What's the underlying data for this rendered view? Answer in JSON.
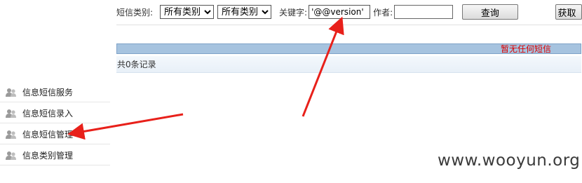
{
  "search": {
    "category_label": "短信类别:",
    "category_select_1": "所有类别",
    "category_select_2": "所有类别",
    "keyword_label": "关键字:",
    "keyword_value": "'@@version'",
    "author_label": "作者:",
    "author_value": "",
    "query_button": "查询",
    "fetch_button": "获取"
  },
  "results": {
    "empty_message": "暂无任何短信",
    "count_text": "共0条记录"
  },
  "sidebar": {
    "items": [
      {
        "label": "信息短信服务",
        "icon": "users-icon"
      },
      {
        "label": "信息短信录入",
        "icon": "users-icon"
      },
      {
        "label": "信息短信管理",
        "icon": "users-icon"
      },
      {
        "label": "信息类别管理",
        "icon": "users-icon"
      }
    ]
  },
  "watermark": "www.wooyun.org",
  "colors": {
    "header_bar": "#a6c3df",
    "empty_message": "#dd0000",
    "annotation_arrow": "#e8201a"
  }
}
